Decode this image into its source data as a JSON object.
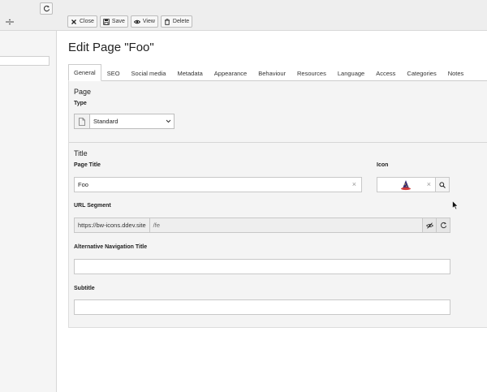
{
  "toolbar": {
    "close_label": "Close",
    "save_label": "Save",
    "view_label": "View",
    "delete_label": "Delete"
  },
  "page_title": "Edit Page \"Foo\"",
  "tabs": [
    {
      "label": "General",
      "active": true
    },
    {
      "label": "SEO"
    },
    {
      "label": "Social media"
    },
    {
      "label": "Metadata"
    },
    {
      "label": "Appearance"
    },
    {
      "label": "Behaviour"
    },
    {
      "label": "Resources"
    },
    {
      "label": "Language"
    },
    {
      "label": "Access"
    },
    {
      "label": "Categories"
    },
    {
      "label": "Notes"
    }
  ],
  "page_section": {
    "title": "Page",
    "type_label": "Type",
    "type_value": "Standard"
  },
  "title_section": {
    "title": "Title",
    "page_title_label": "Page Title",
    "page_title_value": "Foo",
    "icon_label": "Icon",
    "url_segment_label": "URL Segment",
    "url_prefix": "https://bw-icons.ddev.site",
    "url_value": "/fe",
    "alt_nav_label": "Alternative Navigation Title",
    "alt_nav_value": "",
    "subtitle_label": "Subtitle",
    "subtitle_value": ""
  },
  "icons": {
    "refresh": "refresh-icon",
    "close": "close-icon",
    "save": "save-icon",
    "view": "eye-icon",
    "delete": "trash-icon",
    "selected_icon": "wizard-hat-icon"
  },
  "colors": {
    "accent": "#4f5b93",
    "toolbar_bg": "#eeeeee"
  }
}
